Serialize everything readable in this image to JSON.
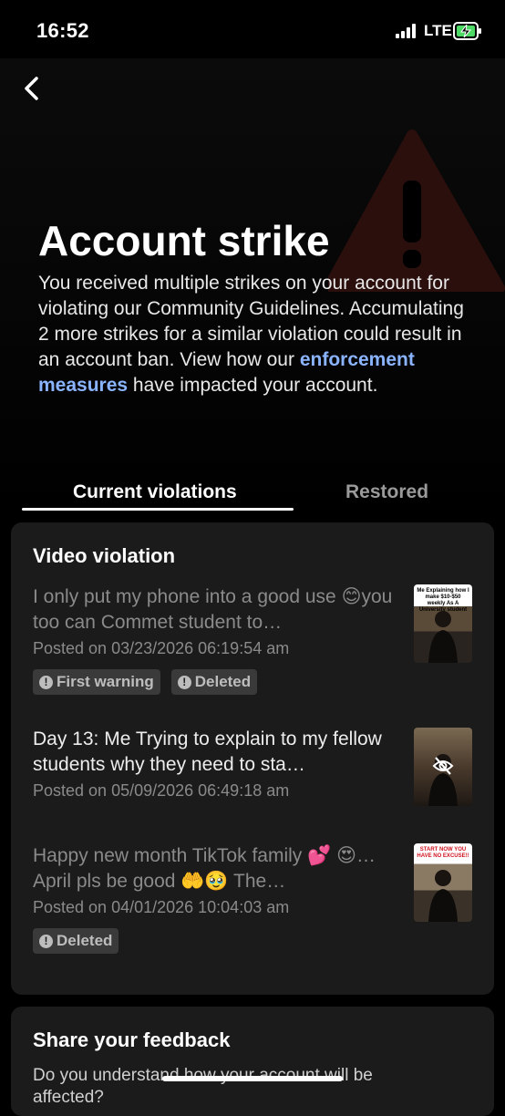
{
  "status_bar": {
    "time": "16:52",
    "network": "LTE"
  },
  "header": {
    "title": "Account strike",
    "description_before": "You received multiple strikes on your account for violating our Community Guidelines. Accumulating 2 more strikes for a similar violation could result in an account ban. View how our ",
    "description_link": "enforcement measures",
    "description_after": " have impacted your account."
  },
  "tabs": [
    {
      "label": "Current violations",
      "selected": true
    },
    {
      "label": "Restored",
      "selected": false
    }
  ],
  "card": {
    "title": "Video violation",
    "violations": [
      {
        "text": "I only put my phone into a good use 😊you too can Commet student to…",
        "date": "Posted on 03/23/2026 06:19:54 am",
        "badges": [
          "First warning",
          "Deleted"
        ],
        "thumb_caption": "Me Explaining how I make $10-$50 weekly As A University student"
      },
      {
        "text": "Day 13: Me Trying to explain to my fellow students why they need to sta…",
        "date": "Posted on 05/09/2026 06:49:18 am",
        "badges": []
      },
      {
        "text": "Happy new month TikTok family 💕 😍…April pls be good 🤲🥹 The…",
        "date": "Posted on 04/01/2026 10:04:03 am",
        "badges": [
          "Deleted"
        ],
        "thumb_caption": "START NOW YOU HAVE NO EXCUSE!!"
      }
    ]
  },
  "feedback": {
    "title": "Share your feedback",
    "question": "Do you understand how your account will be affected?"
  },
  "colors": {
    "link": "#8ab4ff",
    "card_bg": "#1b1b1b",
    "badge_bg": "#3a3a3a"
  }
}
